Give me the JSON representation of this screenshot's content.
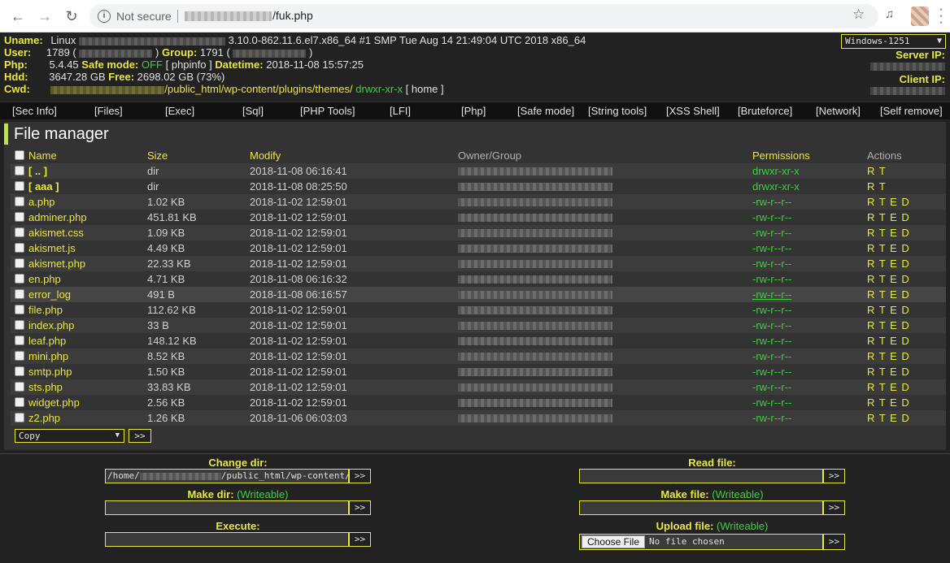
{
  "browser": {
    "security_label": "Not secure",
    "url_path": "/fuk.php",
    "star_glyph": "☆",
    "back_glyph": "←",
    "forward_glyph": "→",
    "reload_glyph": "↻"
  },
  "header": {
    "uname_label": "Uname:",
    "uname_os": "Linux",
    "uname_rest": "3.10.0-862.11.6.el7.x86_64 #1 SMP Tue Aug 14 21:49:04 UTC 2018 x86_64",
    "user_label": "User:",
    "user_id": "1789 (",
    "group_label": "Group:",
    "group_id": "1791 (",
    "close_paren": ")",
    "php_label": "Php:",
    "php_version": "5.4.45",
    "safe_mode_label": "Safe mode:",
    "safe_mode_value": "OFF",
    "phpinfo_link": "[ phpinfo ]",
    "datetime_label": "Datetime:",
    "datetime_value": "2018-11-08 15:57:25",
    "hdd_label": "Hdd:",
    "hdd_total": "3647.28 GB",
    "free_label": "Free:",
    "hdd_free": "2698.02 GB (73%)",
    "cwd_label": "Cwd:",
    "cwd_path": "/public_html/wp-content/plugins/themes/",
    "cwd_perms": "drwxr-xr-x",
    "home_link": "[ home ]",
    "encoding": "Windows-1251",
    "server_ip_label": "Server IP:",
    "client_ip_label": "Client IP:"
  },
  "nav": [
    "[Sec Info]",
    "[Files]",
    "[Exec]",
    "[Sql]",
    "[PHP Tools]",
    "[LFI]",
    "[Php]",
    "[Safe mode]",
    "[String tools]",
    "[XSS Shell]",
    "[Bruteforce]",
    "[Network]",
    "[Self remove]"
  ],
  "file_manager": {
    "title": "File manager",
    "columns": {
      "name": "Name",
      "size": "Size",
      "modify": "Modify",
      "owner": "Owner/Group",
      "perms": "Permissions",
      "actions": "Actions"
    },
    "rows": [
      {
        "name": "[ .. ]",
        "size": "dir",
        "modify": "2018-11-08 06:16:41",
        "perms": "drwxr-xr-x",
        "actions": "R T"
      },
      {
        "name": "[ aaa ]",
        "size": "dir",
        "modify": "2018-11-08 08:25:50",
        "perms": "drwxr-xr-x",
        "actions": "R T"
      },
      {
        "name": "a.php",
        "size": "1.02 KB",
        "modify": "2018-11-02 12:59:01",
        "perms": "-rw-r--r--",
        "actions": "R T E D"
      },
      {
        "name": "adminer.php",
        "size": "451.81 KB",
        "modify": "2018-11-02 12:59:01",
        "perms": "-rw-r--r--",
        "actions": "R T E D"
      },
      {
        "name": "akismet.css",
        "size": "1.09 KB",
        "modify": "2018-11-02 12:59:01",
        "perms": "-rw-r--r--",
        "actions": "R T E D"
      },
      {
        "name": "akismet.js",
        "size": "4.49 KB",
        "modify": "2018-11-02 12:59:01",
        "perms": "-rw-r--r--",
        "actions": "R T E D"
      },
      {
        "name": "akismet.php",
        "size": "22.33 KB",
        "modify": "2018-11-02 12:59:01",
        "perms": "-rw-r--r--",
        "actions": "R T E D"
      },
      {
        "name": "en.php",
        "size": "4.71 KB",
        "modify": "2018-11-08 06:16:32",
        "perms": "-rw-r--r--",
        "actions": "R T E D"
      },
      {
        "name": "error_log",
        "size": "491 B",
        "modify": "2018-11-08 06:16:57",
        "perms": "-rw-r--r--",
        "actions": "R T E D"
      },
      {
        "name": "file.php",
        "size": "112.62 KB",
        "modify": "2018-11-02 12:59:01",
        "perms": "-rw-r--r--",
        "actions": "R T E D"
      },
      {
        "name": "index.php",
        "size": "33 B",
        "modify": "2018-11-02 12:59:01",
        "perms": "-rw-r--r--",
        "actions": "R T E D"
      },
      {
        "name": "leaf.php",
        "size": "148.12 KB",
        "modify": "2018-11-02 12:59:01",
        "perms": "-rw-r--r--",
        "actions": "R T E D"
      },
      {
        "name": "mini.php",
        "size": "8.52 KB",
        "modify": "2018-11-02 12:59:01",
        "perms": "-rw-r--r--",
        "actions": "R T E D"
      },
      {
        "name": "smtp.php",
        "size": "1.50 KB",
        "modify": "2018-11-02 12:59:01",
        "perms": "-rw-r--r--",
        "actions": "R T E D"
      },
      {
        "name": "sts.php",
        "size": "33.83 KB",
        "modify": "2018-11-02 12:59:01",
        "perms": "-rw-r--r--",
        "actions": "R T E D"
      },
      {
        "name": "widget.php",
        "size": "2.56 KB",
        "modify": "2018-11-02 12:59:01",
        "perms": "-rw-r--r--",
        "actions": "R T E D"
      },
      {
        "name": "z2.php",
        "size": "1.26 KB",
        "modify": "2018-11-06 06:03:03",
        "perms": "-rw-r--r--",
        "actions": "R T E D"
      }
    ],
    "bulk_action": "Copy",
    "go_label": ">>"
  },
  "forms": {
    "change_dir": {
      "title": "Change dir:",
      "value": "/home/",
      "value_tail": "/public_html/wp-content/"
    },
    "make_dir": {
      "title": "Make dir:",
      "note": "(Writeable)"
    },
    "execute": {
      "title": "Execute:"
    },
    "read_file": {
      "title": "Read file:"
    },
    "make_file": {
      "title": "Make file:",
      "note": "(Writeable)"
    },
    "upload_file": {
      "title": "Upload file:",
      "note": "(Writeable)",
      "choose_label": "Choose File",
      "no_file": "No file chosen"
    },
    "submit_label": ">>"
  },
  "colors": {
    "accent": "#e8e83c",
    "ok_green": "#3fcf3f",
    "bar_green": "#b8e63c",
    "bg": "#222222"
  }
}
